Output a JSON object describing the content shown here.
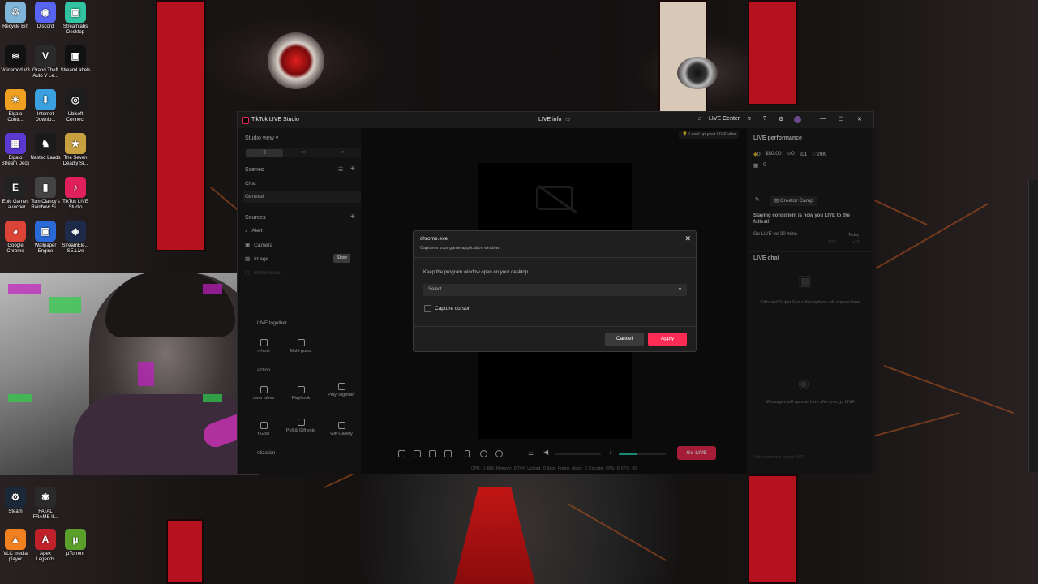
{
  "desktop": {
    "icons": [
      {
        "label": "Recycle Bin",
        "icon": "recycle-bin-icon",
        "color": "#7fb5d9",
        "glyph": "♲"
      },
      {
        "label": "Discord",
        "icon": "discord-icon",
        "color": "#5865f2",
        "glyph": "◉"
      },
      {
        "label": "Streamlabs Desktop",
        "icon": "streamlabs-icon",
        "color": "#31c3a2",
        "glyph": "▣"
      },
      {
        "label": "Voicemod V3",
        "icon": "voicemod-icon",
        "color": "#111111",
        "glyph": "≋"
      },
      {
        "label": "Grand Theft Auto V Le...",
        "icon": "gta-icon",
        "color": "#2a2a2a",
        "glyph": "V"
      },
      {
        "label": "StreamLabels",
        "icon": "streamlabels-icon",
        "color": "#111111",
        "glyph": "▣"
      },
      {
        "label": "Elgato Contr...",
        "icon": "elgato-control-icon",
        "color": "#f0a020",
        "glyph": "☀"
      },
      {
        "label": "Internet Downlo...",
        "icon": "idm-icon",
        "color": "#3aa0e0",
        "glyph": "⬇"
      },
      {
        "label": "Ubisoft Connect",
        "icon": "ubisoft-icon",
        "color": "#1d1d1d",
        "glyph": "◎"
      },
      {
        "label": "Elgato Stream Deck",
        "icon": "stream-deck-icon",
        "color": "#5a3ad0",
        "glyph": "▦"
      },
      {
        "label": "Nested Lands",
        "icon": "nested-lands-icon",
        "color": "#1a1a1a",
        "glyph": "♞"
      },
      {
        "label": "The Seven Deadly Si...",
        "icon": "seven-deadly-icon",
        "color": "#c8a040",
        "glyph": "★"
      },
      {
        "label": "Epic Games Launcher",
        "icon": "epic-games-icon",
        "color": "#222222",
        "glyph": "E"
      },
      {
        "label": "Tom Clancy's Rainbow Si...",
        "icon": "rainbow-six-icon",
        "color": "#444444",
        "glyph": "▮"
      },
      {
        "label": "TikTok LIVE Studio",
        "icon": "tiktok-live-icon",
        "color": "#e0205a",
        "glyph": "♪"
      },
      {
        "label": "Google Chrome",
        "icon": "chrome-icon",
        "color": "#db4437",
        "glyph": "◕"
      },
      {
        "label": "Wallpaper Engine",
        "icon": "wallpaper-engine-icon",
        "color": "#2a6ad8",
        "glyph": "▣"
      },
      {
        "label": "StreamEle... SE.Live",
        "icon": "streamelements-icon",
        "color": "#1e2a4a",
        "glyph": "◈"
      }
    ],
    "bottom_icons": [
      {
        "label": "Steam",
        "icon": "steam-icon",
        "color": "#1b2838",
        "glyph": "⚙"
      },
      {
        "label": "FATAL FRAME II...",
        "icon": "fatal-frame-icon",
        "color": "#2a2a2a",
        "glyph": "✾"
      },
      {
        "label": "VLC media player",
        "icon": "vlc-icon",
        "color": "#f08020",
        "glyph": "▲"
      },
      {
        "label": "Apex Legends",
        "icon": "apex-icon",
        "color": "#c0202a",
        "glyph": "A"
      },
      {
        "label": "µTorrent",
        "icon": "utorrent-icon",
        "color": "#5aa02a",
        "glyph": "µ"
      }
    ]
  },
  "app": {
    "title": "TikTok LIVE Studio",
    "center_title": "LIVE info",
    "live_center": "LIVE Center",
    "studio_view": "Studio view",
    "scenes_label": "Scenes",
    "scenes": [
      "Chat",
      "General"
    ],
    "sources_label": "Sources",
    "sources": [
      "Alert",
      "Camera",
      "Image",
      "chrome.exe"
    ],
    "tooltip": "Show",
    "live_together": "LIVE together",
    "tools": [
      {
        "label": "o-host"
      },
      {
        "label": "Multi-guest"
      },
      {
        "label": "ower\nishes"
      },
      {
        "label": "Playbook"
      },
      {
        "label": "Play Together"
      },
      {
        "label": "t Goal"
      },
      {
        "label": "Poll & Gift vote"
      },
      {
        "label": "Gift Gallery"
      }
    ],
    "section_interaction": "action",
    "section_monetization": "etization",
    "vibe": "Level up your LIVE vibe",
    "go_live": "Go LIVE",
    "status": "CPU: 0.48%   Memory: 0.74%   Upload: 0 kbps   Frame drops: 0   Encoder FPS: 0   FPS: 60"
  },
  "performance": {
    "title": "LIVE performance",
    "diamonds": "0",
    "money": "$0.00",
    "viewers": "0",
    "new": "1",
    "likes": "20K",
    "gifts": "0",
    "creator_camp": "Creator Camp",
    "consistency": "Staying consistent is how you LIVE to the fullest!",
    "go_live_for": "Go LIVE for 30 mins",
    "today": "Today",
    "progress": "0/30",
    "reward": "+20"
  },
  "chat": {
    "title": "LIVE chat",
    "gifts_note": "Gifts and Super Fan subscriptions will appear here",
    "messages_note": "Messages will appear here after you go LIVE",
    "input_placeholder": "Add comments during LIVE"
  },
  "dialog": {
    "title": "chrome.exe",
    "subtitle": "Captures your game application window.",
    "keep_label": "Keep the program window open on your desktop",
    "select_placeholder": "Select",
    "capture_cursor": "Capture cursor",
    "cancel": "Cancel",
    "apply": "Apply"
  },
  "colors": {
    "accent": "#fe2c55",
    "teal": "#25d3b5",
    "banner": "#b3121e"
  }
}
